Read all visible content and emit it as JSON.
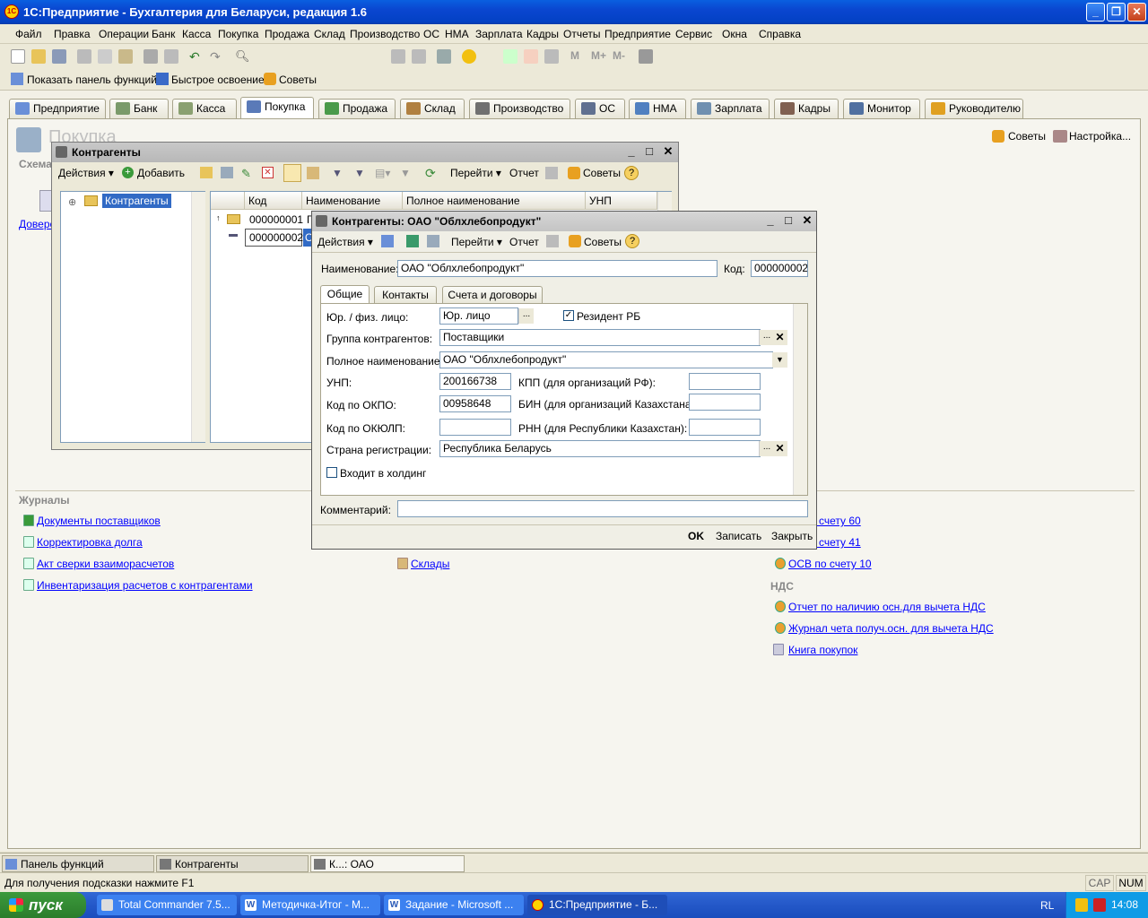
{
  "app": {
    "title": "1С:Предприятие - Бухгалтерия для Беларуси, редакция 1.6",
    "icon_text": "1С"
  },
  "menu": [
    "Файл",
    "Правка",
    "Операции",
    "Банк",
    "Касса",
    "Покупка",
    "Продажа",
    "Склад",
    "Производство",
    "ОС",
    "НМА",
    "Зарплата",
    "Кадры",
    "Отчеты",
    "Предприятие",
    "Сервис",
    "Окна",
    "Справка"
  ],
  "toolbar2": {
    "show_panel": "Показать панель функций",
    "quick": "Быстрое освоение",
    "tips": "Советы"
  },
  "tabs": [
    {
      "label": "Предприятие",
      "color": "#6a8fd8"
    },
    {
      "label": "Банк",
      "color": "#7a9a6a"
    },
    {
      "label": "Касса",
      "color": "#8aa070"
    },
    {
      "label": "Покупка",
      "color": "#5a7ab8",
      "active": true
    },
    {
      "label": "Продажа",
      "color": "#4a9a4a"
    },
    {
      "label": "Склад",
      "color": "#b08040"
    },
    {
      "label": "Производство",
      "color": "#707070"
    },
    {
      "label": "ОС",
      "color": "#607090"
    },
    {
      "label": "НМА",
      "color": "#5080c0"
    },
    {
      "label": "Зарплата",
      "color": "#7090b0"
    },
    {
      "label": "Кадры",
      "color": "#806050"
    },
    {
      "label": "Монитор",
      "color": "#5070a0"
    },
    {
      "label": "Руководителю",
      "color": "#e0a020"
    }
  ],
  "panel": {
    "title": "Покупка",
    "scheme": "Схема",
    "dover": "Довере",
    "tips": "Советы",
    "settings": "Настройка...",
    "journals_header": "Журналы",
    "journals": [
      "Документы поставщиков",
      "Корректировка долга",
      "Акт сверки взаиморасчетов",
      "Инвентаризация расчетов с контрагентами"
    ],
    "middle_links": [
      "Склады"
    ],
    "right_links_top": [
      "о счету 60",
      "о счету 41",
      "ОСВ по счету 10"
    ],
    "vat_header": "НДС",
    "vat_links": [
      "Отчет по наличию осн.для вычета НДС",
      "Журнал чета получ.осн. для вычета НДС",
      "Книга покупок"
    ]
  },
  "kontragenty": {
    "title": "Контрагенты",
    "actions": "Действия",
    "add": "Добавить",
    "goto": "Перейти",
    "report": "Отчет",
    "tips": "Советы",
    "tree_root": "Контрагенты",
    "columns": [
      "Код",
      "Наименование",
      "Полное наименование",
      "УНП"
    ],
    "rows": [
      {
        "code": "000000001",
        "name": "Г"
      },
      {
        "code": "000000002",
        "name": "О"
      }
    ]
  },
  "form": {
    "title": "Контрагенты: ОАО \"Облхлебопродукт\"",
    "actions": "Действия",
    "goto": "Перейти",
    "report": "Отчет",
    "tips": "Советы",
    "name_label": "Наименование:",
    "name_value": "ОАО \"Облхлебопродукт\"",
    "code_label": "Код:",
    "code_value": "000000002",
    "tabs": [
      "Общие",
      "Контакты",
      "Счета и договоры"
    ],
    "legal_label": "Юр. / физ. лицо:",
    "legal_value": "Юр. лицо",
    "resident_label": "Резидент РБ",
    "group_label": "Группа контрагентов:",
    "group_value": "Поставщики",
    "fullname_label": "Полное наименование:",
    "fullname_value": "ОАО \"Облхлебопродукт\"",
    "unp_label": "УНП:",
    "unp_value": "200166738",
    "kpp_label": "КПП (для организаций РФ):",
    "okpo_label": "Код по ОКПО:",
    "okpo_value": "00958648",
    "bin_label": "БИН (для организаций Казахстана):",
    "okyulp_label": "Код по ОКЮЛП:",
    "rnn_label": "РНН (для Республики Казахстан):",
    "country_label": "Страна регистрации:",
    "country_value": "Республика Беларусь",
    "holding_label": "Входит в холдинг",
    "comment_label": "Комментарий:",
    "ok": "OK",
    "save": "Записать",
    "close": "Закрыть"
  },
  "taskstrip": [
    "Панель функций",
    "Контрагенты",
    "К...: ОАО \"Облхлебопродукт\""
  ],
  "status": {
    "hint": "Для получения подсказки нажмите F1",
    "cap": "CAP",
    "num": "NUM"
  },
  "taskbar": {
    "start": "пуск",
    "items": [
      "Total Commander 7.5...",
      "Методичка-Итог - M...",
      "Задание - Microsoft ...",
      "1С:Предприятие - Б..."
    ],
    "lang": "RL",
    "clock": "14:08"
  }
}
